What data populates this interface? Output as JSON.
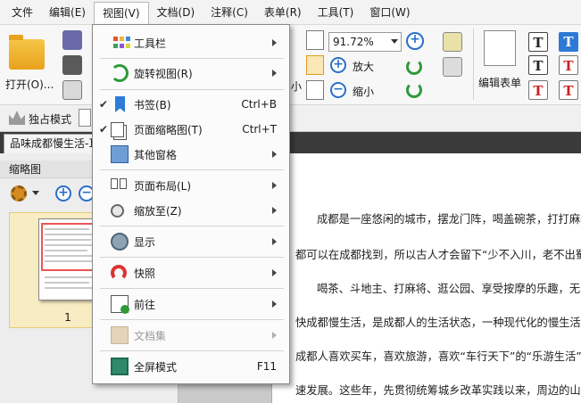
{
  "menubar": {
    "items": [
      "文件",
      "编辑(E)",
      "视图(V)",
      "文档(D)",
      "注释(C)",
      "表单(R)",
      "工具(T)",
      "窗口(W)"
    ]
  },
  "ribbon": {
    "open_label": "打开(O)...",
    "zoom_value": "91.72%",
    "zoom_in_label": "放大",
    "zoom_out_label": "缩小",
    "edit_form_label": "编辑表单",
    "partial_label": "小"
  },
  "toolbar2": {
    "exclusive_mode_label": "独占模式"
  },
  "tabs": {
    "doc_tab_label": "品味成都慢生活-耳"
  },
  "thumbnail_panel": {
    "title": "缩略图",
    "page_number": "1"
  },
  "view_menu": {
    "items": [
      {
        "label": "工具栏",
        "shortcut": "",
        "checked": false,
        "submenu": true,
        "disabled": false,
        "icon": "toolbar-icon"
      },
      {
        "label": "旋转视图(R)",
        "shortcut": "",
        "checked": false,
        "submenu": true,
        "disabled": false,
        "icon": "rotate-icon"
      },
      {
        "label": "书签(B)",
        "shortcut": "Ctrl+B",
        "checked": true,
        "submenu": false,
        "disabled": false,
        "icon": "bookmark-icon"
      },
      {
        "label": "页面缩略图(T)",
        "shortcut": "Ctrl+T",
        "checked": true,
        "submenu": false,
        "disabled": false,
        "icon": "page-thumbnails-icon"
      },
      {
        "label": "其他窗格",
        "shortcut": "",
        "checked": false,
        "submenu": true,
        "disabled": false,
        "icon": "panes-icon"
      },
      {
        "label": "页面布局(L)",
        "shortcut": "",
        "checked": false,
        "submenu": true,
        "disabled": false,
        "icon": "page-layout-icon"
      },
      {
        "label": "缩放至(Z)",
        "shortcut": "",
        "checked": false,
        "submenu": true,
        "disabled": false,
        "icon": "zoom-icon"
      },
      {
        "label": "显示",
        "shortcut": "",
        "checked": false,
        "submenu": true,
        "disabled": false,
        "icon": "show-icon"
      },
      {
        "label": "快照",
        "shortcut": "",
        "checked": false,
        "submenu": true,
        "disabled": false,
        "icon": "snapshot-icon"
      },
      {
        "label": "前往",
        "shortcut": "",
        "checked": false,
        "submenu": true,
        "disabled": false,
        "icon": "goto-icon"
      },
      {
        "label": "文档集",
        "shortcut": "",
        "checked": false,
        "submenu": true,
        "disabled": true,
        "icon": "document-set-icon"
      },
      {
        "label": "全屏模式",
        "shortcut": "F11",
        "checked": false,
        "submenu": false,
        "disabled": false,
        "icon": "fullscreen-icon"
      }
    ],
    "check_mark": "✔"
  },
  "document": {
    "lines": [
      "成都是一座悠闲的城市，摆龙门阵，喝盖碗茶，打打麻将",
      "都可以在成都找到，所以古人才会留下“少不入川，老不出蜀",
      "喝茶、斗地主、打麻将、逛公园、享受按摩的乐趣，无",
      "快成都慢生活，是成都人的生活状态，一种现代化的慢生活方",
      "成都人喜欢买车，喜欢旅游，喜欢“车行天下”的“乐游生活”",
      "速发展。这些年，先贯彻统筹城乡改革实践以来，周边的山 会"
    ]
  }
}
